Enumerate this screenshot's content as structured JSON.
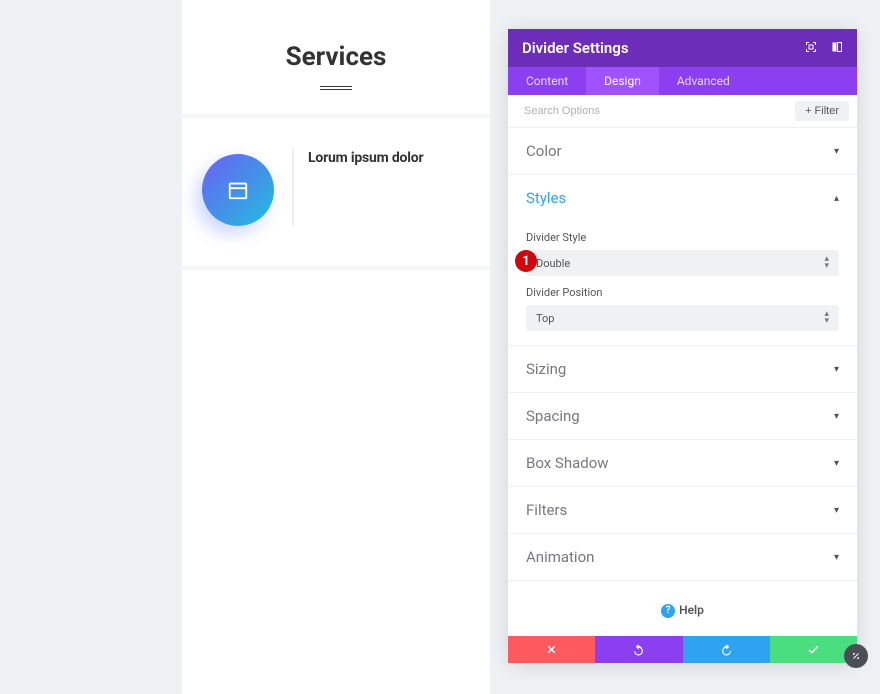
{
  "preview": {
    "title": "Services",
    "card_heading": "Lorum ipsum dolor"
  },
  "panel": {
    "title": "Divider Settings",
    "tabs": {
      "content": "Content",
      "design": "Design",
      "advanced": "Advanced"
    },
    "search_placeholder": "Search Options",
    "filter_label": "Filter",
    "sections": {
      "color": "Color",
      "styles": "Styles",
      "sizing": "Sizing",
      "spacing": "Spacing",
      "box_shadow": "Box Shadow",
      "filters": "Filters",
      "animation": "Animation"
    },
    "styles_fields": {
      "divider_style_label": "Divider Style",
      "divider_style_value": "Double",
      "divider_position_label": "Divider Position",
      "divider_position_value": "Top"
    },
    "help_label": "Help",
    "annotation_1": "1"
  }
}
